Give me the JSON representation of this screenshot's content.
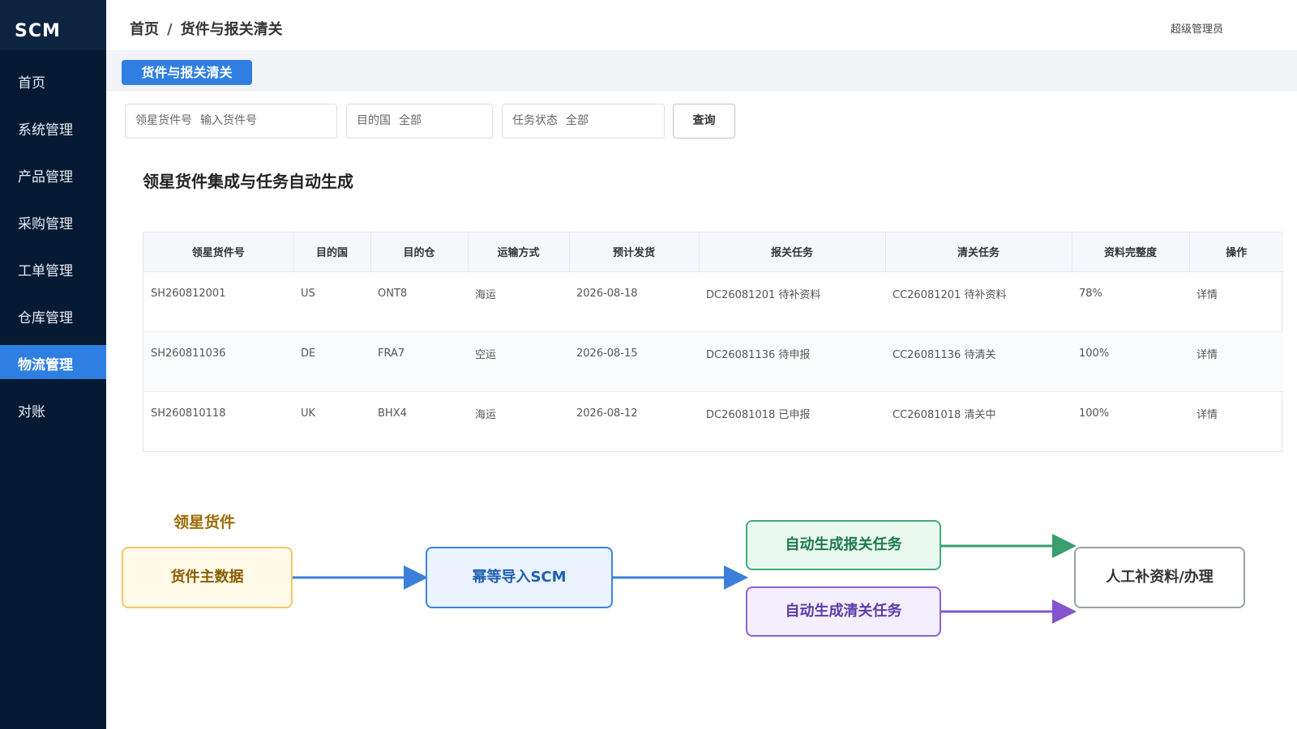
{
  "sidebar": {
    "brand": "SCM",
    "items": [
      {
        "label": "首页",
        "active": false
      },
      {
        "label": "系统管理",
        "active": false
      },
      {
        "label": "产品管理",
        "active": false
      },
      {
        "label": "采购管理",
        "active": false
      },
      {
        "label": "工单管理",
        "active": false
      },
      {
        "label": "仓库管理",
        "active": false
      },
      {
        "label": "物流管理",
        "active": true
      },
      {
        "label": "对账",
        "active": false
      }
    ]
  },
  "header": {
    "breadcrumb_home": "首页",
    "breadcrumb_sep": "/",
    "breadcrumb_current": "货件与报关清关",
    "user": "超级管理员"
  },
  "tabs": [
    {
      "label": "货件与报关清关"
    }
  ],
  "filters": {
    "shipment_label": "领星货件号",
    "shipment_placeholder": "输入货件号",
    "country_label": "目的国",
    "country_value": "全部",
    "status_label": "任务状态",
    "status_value": "全部",
    "query_button": "查询"
  },
  "section_title": "领星货件集成与任务自动生成",
  "table": {
    "columns": [
      "领星货件号",
      "目的国",
      "目的仓",
      "运输方式",
      "预计发货",
      "报关任务",
      "清关任务",
      "资料完整度",
      "操作"
    ],
    "rows": [
      [
        "SH260812001",
        "US",
        "ONT8",
        "海运",
        "2026-08-18",
        "DC26081201 待补资料",
        "CC26081201 待补资料",
        "78%",
        "详情"
      ],
      [
        "SH260811036",
        "DE",
        "FRA7",
        "空运",
        "2026-08-15",
        "DC26081136 待申报",
        "CC26081136 待清关",
        "100%",
        "详情"
      ],
      [
        "SH260810118",
        "UK",
        "BHX4",
        "海运",
        "2026-08-12",
        "DC26081018 已申报",
        "CC26081018 清关中",
        "100%",
        "详情"
      ]
    ]
  },
  "flow": {
    "label": "领星货件",
    "nodes": {
      "master": "货件主数据",
      "import": "幂等导入SCM",
      "declaration": "自动生成报关任务",
      "clearance": "自动生成清关任务",
      "manual": "人工补资料/办理"
    },
    "colors": {
      "blue": "#3a7fd9",
      "green": "#3a9e6e",
      "purple": "#8455cc"
    }
  }
}
